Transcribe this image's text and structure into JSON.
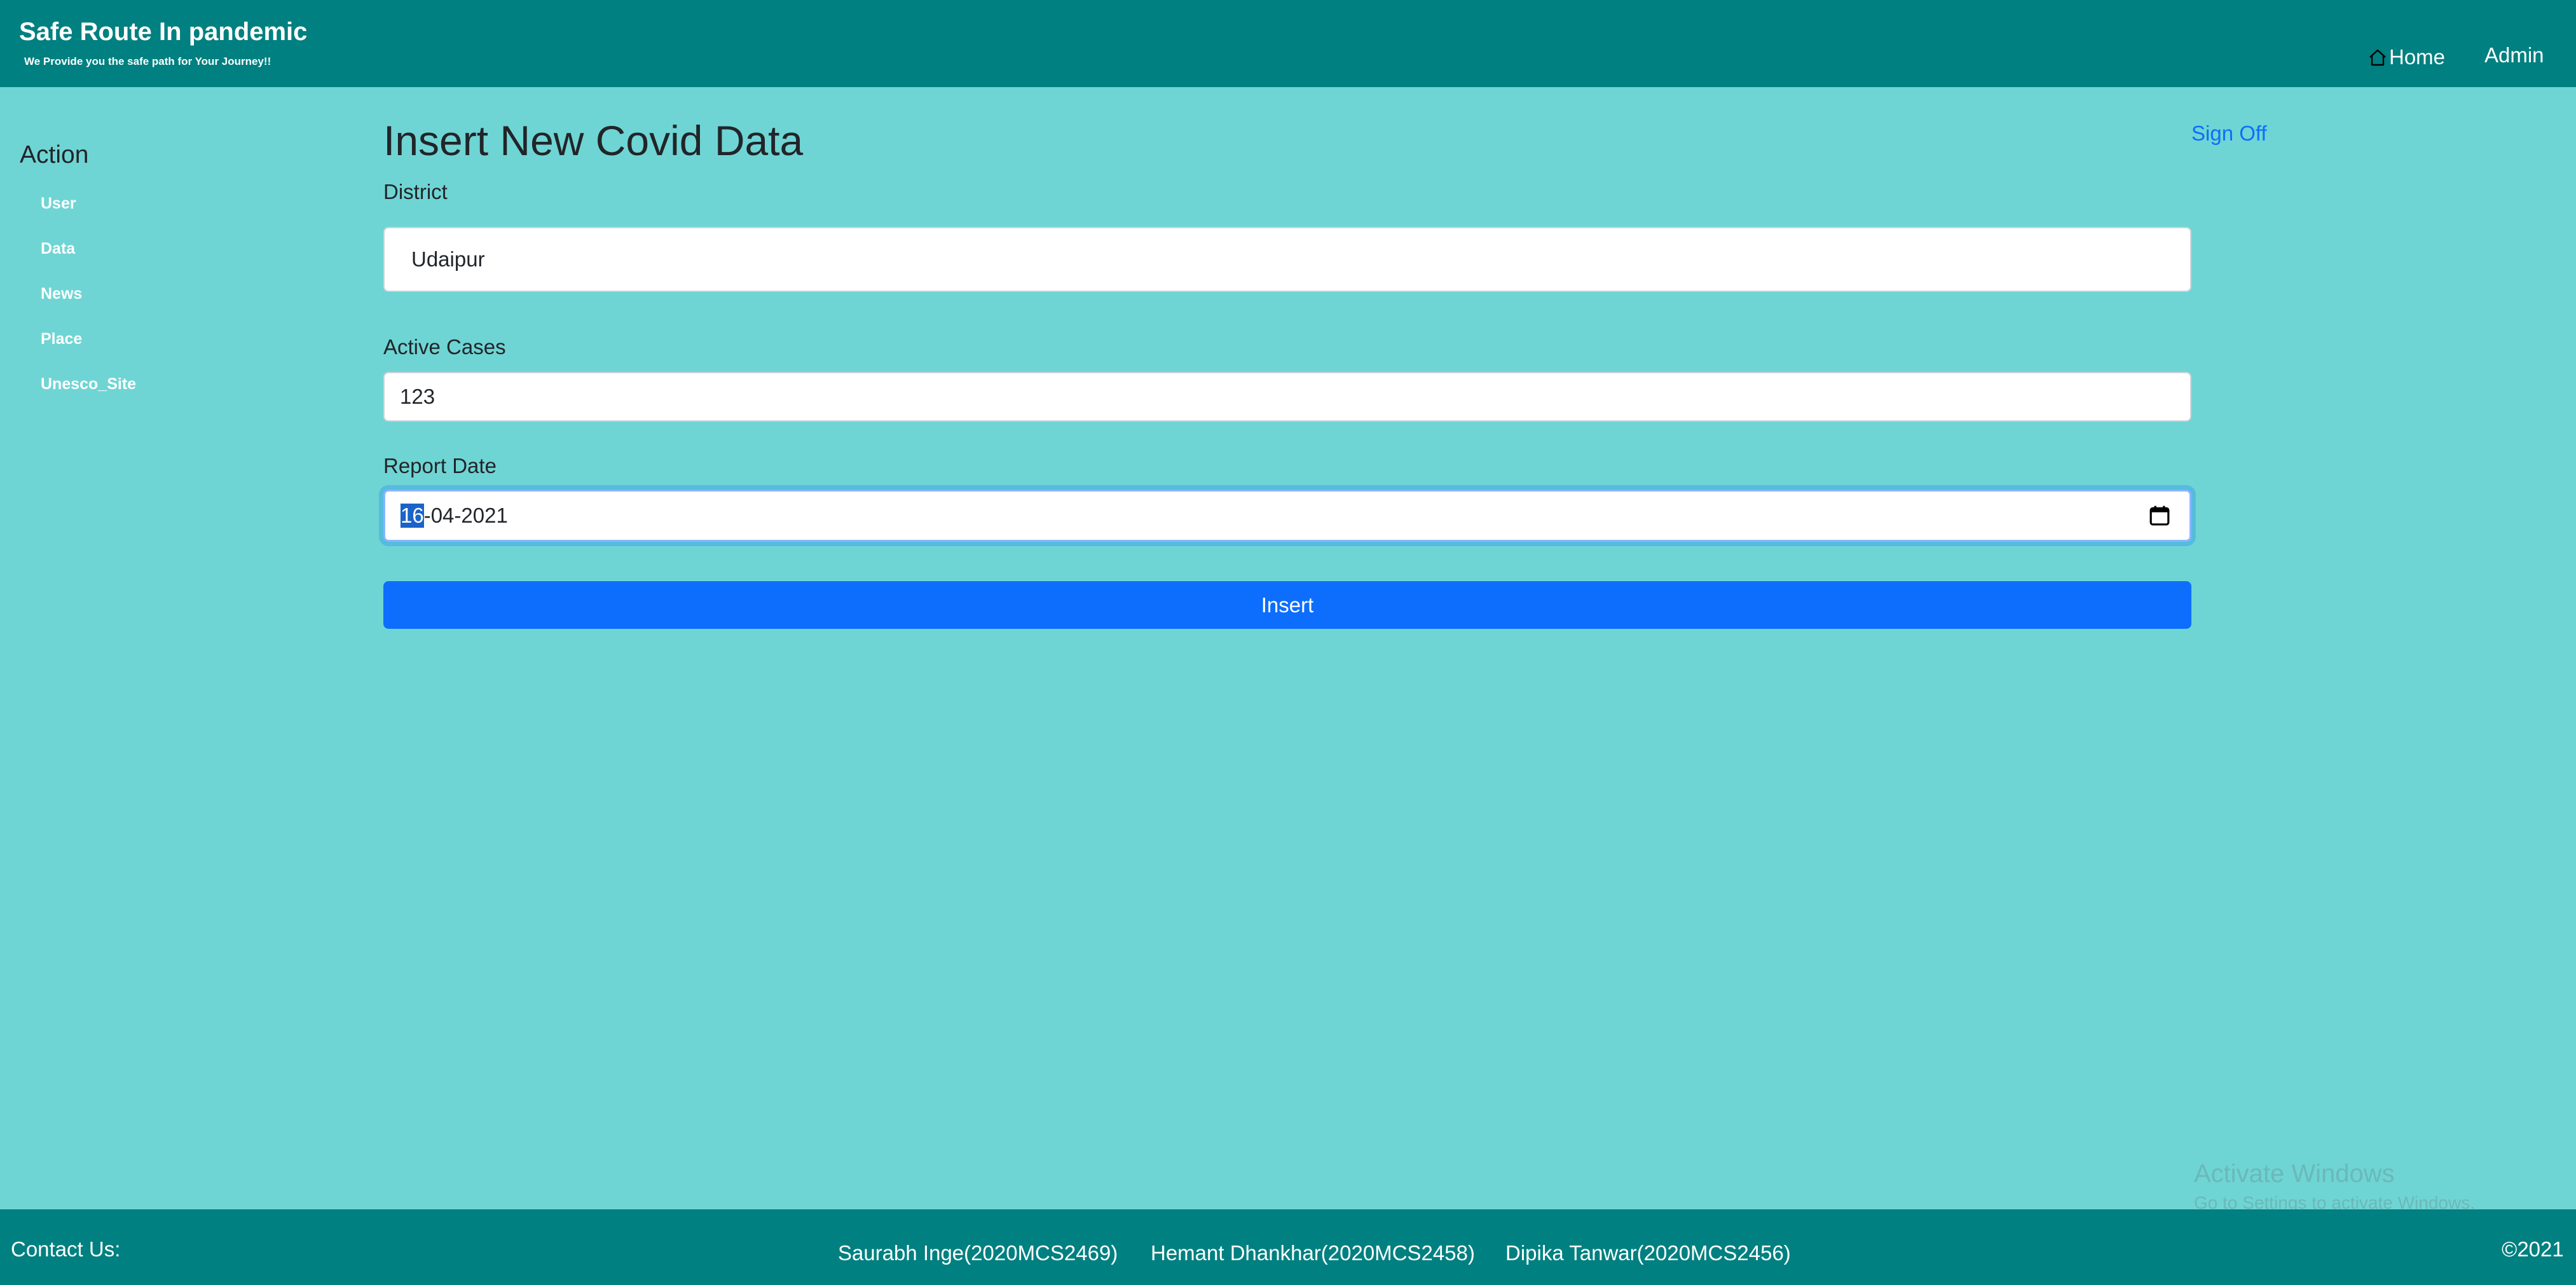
{
  "header": {
    "title": "Safe Route In pandemic",
    "tagline": "We Provide you the safe path for Your Journey!!",
    "nav": {
      "home_label": "Home",
      "admin_label": "Admin"
    }
  },
  "sidebar": {
    "heading": "Action",
    "items": [
      {
        "label": "User"
      },
      {
        "label": "Data"
      },
      {
        "label": "News"
      },
      {
        "label": "Place"
      },
      {
        "label": "Unesco_Site"
      }
    ]
  },
  "main": {
    "title": "Insert New Covid Data",
    "sign_off_label": "Sign Off",
    "form": {
      "district": {
        "label": "District",
        "value": "Udaipur"
      },
      "active_cases": {
        "label": "Active Cases",
        "value": "123"
      },
      "report_date": {
        "label": "Report Date",
        "value": "16-04-2021",
        "day_part": "16",
        "rest_part": "-04-2021"
      },
      "submit_label": "Insert"
    }
  },
  "watermark": {
    "title": "Activate Windows",
    "subtitle": "Go to Settings to activate Windows."
  },
  "footer": {
    "contact_label": "Contact Us:",
    "members": [
      "Saurabh Inge(2020MCS2469)",
      "Hemant Dhankhar(2020MCS2458)",
      "Dipika Tanwar(2020MCS2456)"
    ],
    "copyright": "©2021"
  },
  "colors": {
    "header_bg": "#008080",
    "page_bg": "#6fd5d4",
    "primary_button": "#0d6efd",
    "link": "#0d6efd"
  }
}
